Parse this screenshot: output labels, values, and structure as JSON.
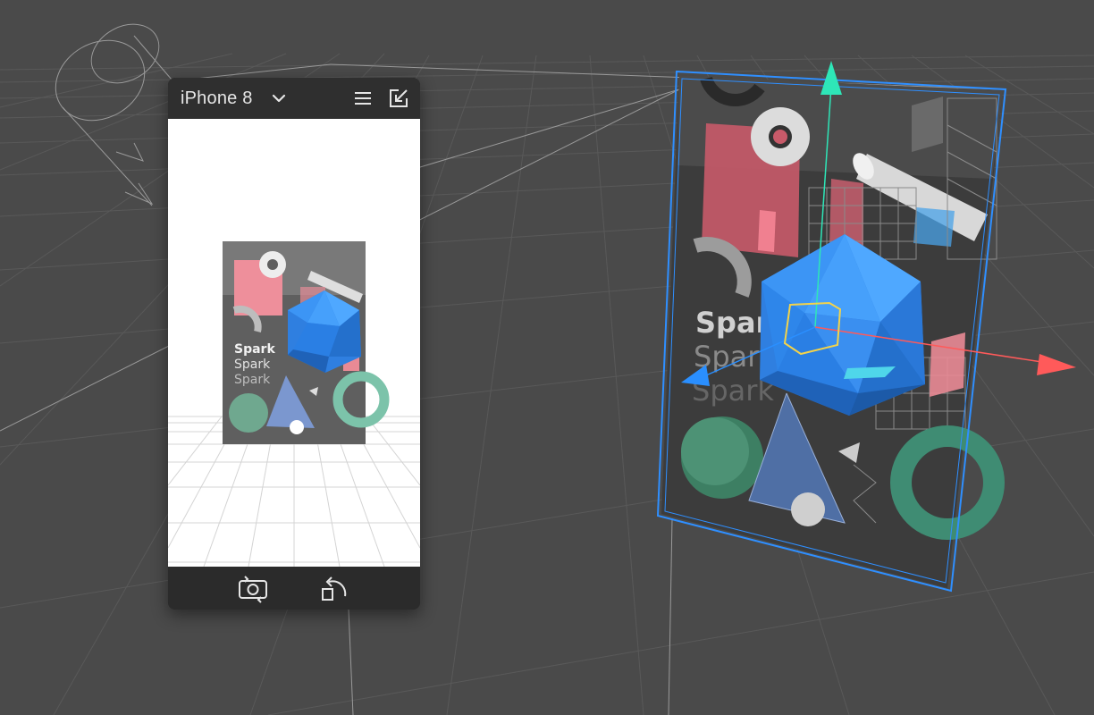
{
  "simulator": {
    "device_name": "iPhone 8",
    "icons": {
      "device_dropdown": "chevron-down-icon",
      "menu": "hamburger-menu-icon",
      "collapse": "collapse-arrow-icon",
      "flip_camera": "flip-camera-icon",
      "reset": "reset-rotate-icon"
    }
  },
  "poster": {
    "line1": "Spark",
    "line2": "Spark",
    "line3": "Spark"
  },
  "colors": {
    "viewport_bg": "#4a4a4a",
    "panel_bg": "#2b2b2b",
    "selection_outline": "#2f8fff",
    "gizmo_x": "#ff5a5a",
    "gizmo_y": "#2ee6b8",
    "gizmo_z": "#2a8fff",
    "icosahedron": "#3d8fe8",
    "pink": "#e98a95",
    "green": "#4d9d86"
  }
}
